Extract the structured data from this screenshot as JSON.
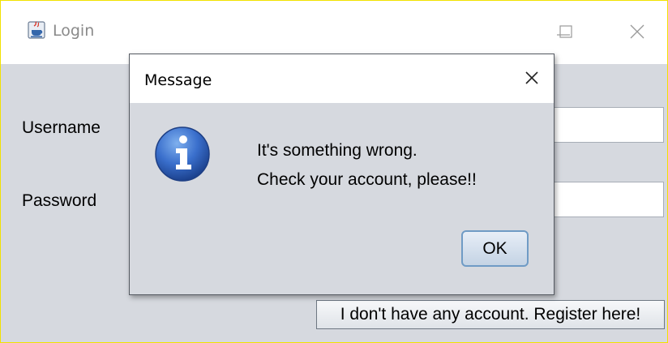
{
  "window": {
    "title": "Login",
    "icon": "java-app-icon",
    "controls": [
      "minimize-icon",
      "maximize-icon",
      "close-icon"
    ]
  },
  "form": {
    "username_label": "Username",
    "username_value": "",
    "password_label": "Password",
    "password_value": "",
    "register_label": "I don't have any account. Register here!"
  },
  "dialog": {
    "title": "Message",
    "icon": "info-icon",
    "message_line1": "It's something wrong.",
    "message_line2": "Check your account, please!!",
    "ok_label": "OK"
  },
  "colors": {
    "window_border": "#f2e200",
    "content_bg": "#d6d9df",
    "info_blue": "#2f68c4"
  }
}
